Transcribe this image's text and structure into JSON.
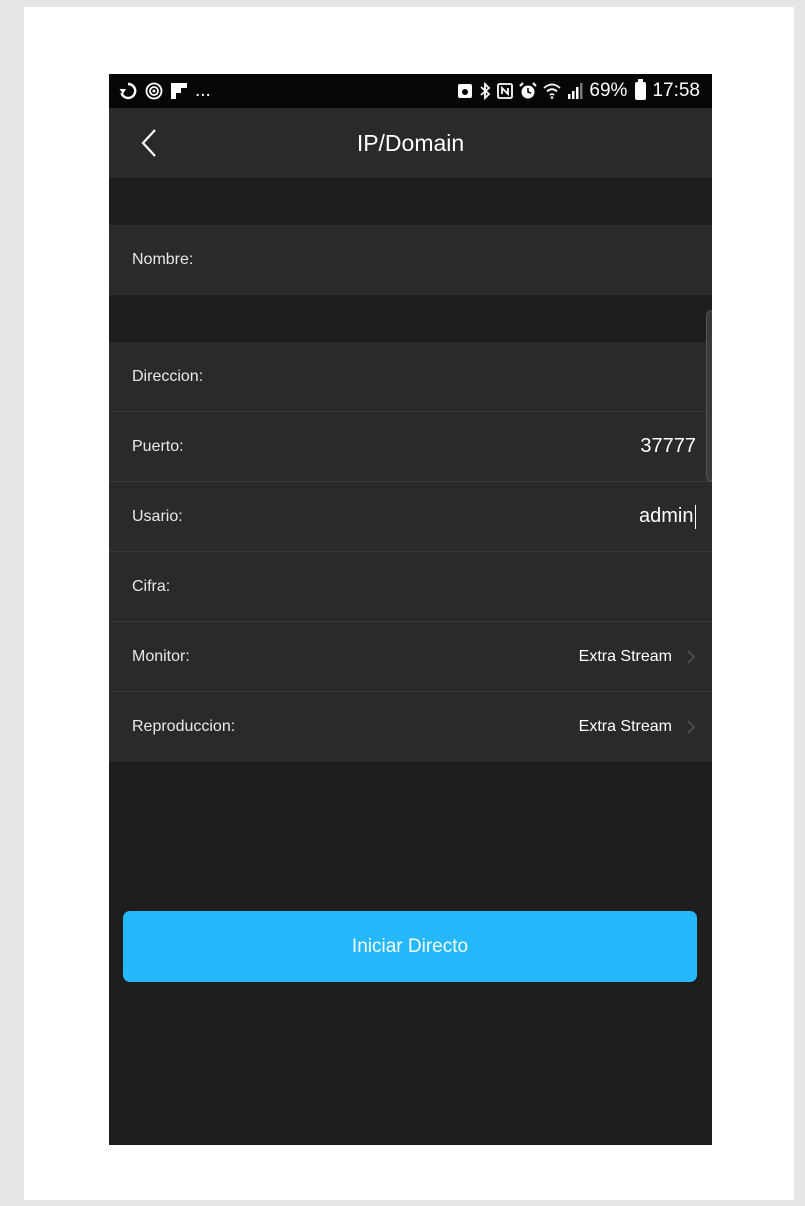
{
  "statusbar": {
    "left_icons": [
      "sync-icon",
      "target-icon",
      "flipboard-icon"
    ],
    "left_more": "...",
    "right_icons": [
      "android-icon",
      "bluetooth-icon",
      "nfc-icon",
      "alarm-icon",
      "wifi-icon",
      "signal-icon"
    ],
    "battery": "69%",
    "time": "17:58"
  },
  "navbar": {
    "back_icon": "chevron-left-icon",
    "title": "IP/Domain"
  },
  "form": {
    "nombre": {
      "label": "Nombre:",
      "value": ""
    },
    "direccion": {
      "label": "Direccion:",
      "value": ""
    },
    "puerto": {
      "label": "Puerto:",
      "value": "37777"
    },
    "usuario": {
      "label": "Usario:",
      "value": "admin"
    },
    "cifra": {
      "label": "Cifra:",
      "value": ""
    },
    "monitor": {
      "label": "Monitor:",
      "value": "Extra Stream"
    },
    "reproduccion": {
      "label": "Reproduccion:",
      "value": "Extra Stream"
    }
  },
  "action": {
    "label": "Iniciar Directo"
  },
  "colors": {
    "accent": "#25b8fb",
    "background": "#1e1e1e",
    "row": "#2a2a2a"
  }
}
